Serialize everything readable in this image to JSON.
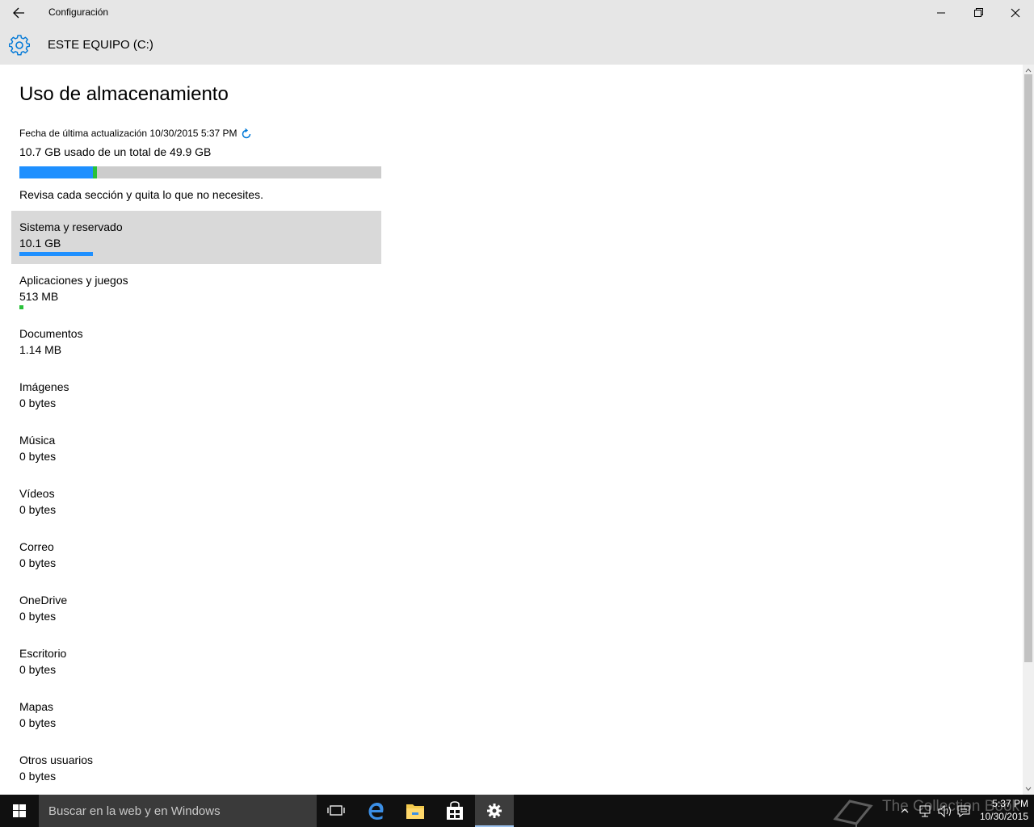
{
  "window": {
    "title": "Configuración"
  },
  "header": {
    "title": "ESTE EQUIPO (C:)"
  },
  "main": {
    "heading": "Uso de almacenamiento",
    "updated": "Fecha de última actualización 10/30/2015 5:37 PM",
    "total": "10.7 GB usado de un total de 49.9 GB",
    "hint": "Revisa cada sección y quita lo que no necesites.",
    "usage_bar": {
      "system_fraction": 0.2024,
      "apps_fraction": 0.0103,
      "system_color": "#1e90ff",
      "apps_color": "#29c13a",
      "empty_color": "#cccccc"
    },
    "categories": [
      {
        "name": "Sistema y reservado",
        "size": "10.1 GB",
        "fraction": 0.2024,
        "color": "#1e90ff",
        "selected": true
      },
      {
        "name": "Aplicaciones y juegos",
        "size": "513 MB",
        "fraction": 0.0103,
        "color": "#29c13a"
      },
      {
        "name": "Documentos",
        "size": "1.14 MB"
      },
      {
        "name": "Imágenes",
        "size": "0 bytes"
      },
      {
        "name": "Música",
        "size": "0 bytes"
      },
      {
        "name": "Vídeos",
        "size": "0 bytes"
      },
      {
        "name": "Correo",
        "size": "0 bytes"
      },
      {
        "name": "OneDrive",
        "size": "0 bytes"
      },
      {
        "name": "Escritorio",
        "size": "0 bytes"
      },
      {
        "name": "Mapas",
        "size": "0 bytes"
      },
      {
        "name": "Otros usuarios",
        "size": "0 bytes"
      }
    ]
  },
  "taskbar": {
    "search_placeholder": "Buscar en la web y en Windows",
    "watermark": "The Collection Book",
    "time": "5:37 PM",
    "date": "10/30/2015",
    "icons": [
      "start-icon",
      "task-view-icon",
      "edge-icon",
      "file-explorer-icon",
      "store-icon",
      "settings-icon"
    ]
  },
  "colors": {
    "accent": "#0078d7",
    "chrome": "#e6e6e6",
    "taskbar": "#101010"
  }
}
